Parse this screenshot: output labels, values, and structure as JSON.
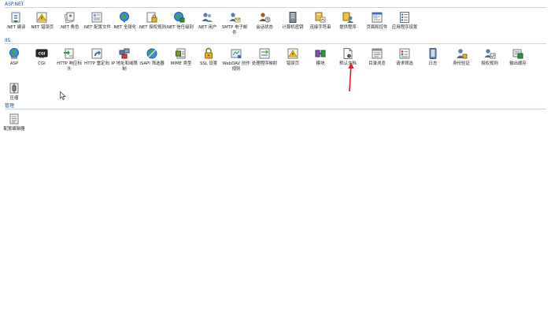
{
  "sections": {
    "aspnet": {
      "title": "ASP.NET",
      "items": [
        {
          "label": ".NET 编译",
          "icon": "compilation-icon"
        },
        {
          "label": ".NET 错误页",
          "icon": "error-pages-icon"
        },
        {
          "label": ".NET 角色",
          "icon": "roles-icon"
        },
        {
          "label": ".NET 配置文件",
          "icon": "profile-icon"
        },
        {
          "label": ".NET 全球化",
          "icon": "globalization-icon"
        },
        {
          "label": ".NET 授权规则",
          "icon": "authorization-icon"
        },
        {
          "label": ".NET 信任级别",
          "icon": "trust-levels-icon"
        },
        {
          "label": ".NET 用户",
          "icon": "users-icon"
        },
        {
          "label": "SMTP 电子邮件",
          "icon": "smtp-icon"
        },
        {
          "label": "会话状态",
          "icon": "session-state-icon"
        },
        {
          "label": "计算机密钥",
          "icon": "machine-key-icon"
        },
        {
          "label": "连接字符串",
          "icon": "connection-strings-icon"
        },
        {
          "label": "提供程序",
          "icon": "providers-icon"
        },
        {
          "label": "页面和控件",
          "icon": "pages-controls-icon"
        },
        {
          "label": "应用程序设置",
          "icon": "app-settings-icon"
        }
      ]
    },
    "iis": {
      "title": "IIS",
      "items": [
        {
          "label": "ASP",
          "icon": "asp-icon"
        },
        {
          "label": "CGI",
          "icon": "cgi-icon"
        },
        {
          "label": "HTTP 响应标头",
          "icon": "http-headers-icon"
        },
        {
          "label": "HTTP 重定向",
          "icon": "http-redirect-icon"
        },
        {
          "label": "IP 地址和域限制",
          "icon": "ip-restrictions-icon"
        },
        {
          "label": "ISAPI 筛选器",
          "icon": "isapi-filters-icon"
        },
        {
          "label": "MIME 类型",
          "icon": "mime-types-icon"
        },
        {
          "label": "SSL 设置",
          "icon": "ssl-lock-icon"
        },
        {
          "label": "WebDAV 创作规则",
          "icon": "webdav-icon"
        },
        {
          "label": "处理程序映射",
          "icon": "handler-mappings-icon"
        },
        {
          "label": "错误页",
          "icon": "error-page-icon"
        },
        {
          "label": "模块",
          "icon": "modules-icon"
        },
        {
          "label": "默认文档",
          "icon": "default-document-icon"
        },
        {
          "label": "目录浏览",
          "icon": "directory-browsing-icon"
        },
        {
          "label": "请求筛选",
          "icon": "request-filtering-icon"
        },
        {
          "label": "日志",
          "icon": "logging-icon"
        },
        {
          "label": "身份验证",
          "icon": "authentication-icon"
        },
        {
          "label": "授权规则",
          "icon": "authorization-rules-icon"
        },
        {
          "label": "输出缓存",
          "icon": "output-caching-icon"
        },
        {
          "label": "压缩",
          "icon": "compression-icon"
        }
      ]
    },
    "management": {
      "title": "管理",
      "items": [
        {
          "label": "配置编辑器",
          "icon": "configuration-editor-icon"
        }
      ]
    }
  },
  "cgi_badge": "CGI",
  "colors": {
    "section_title": "#1e4e8c",
    "rule": "#c8d4e4",
    "annotation_arrow": "#d22222"
  }
}
